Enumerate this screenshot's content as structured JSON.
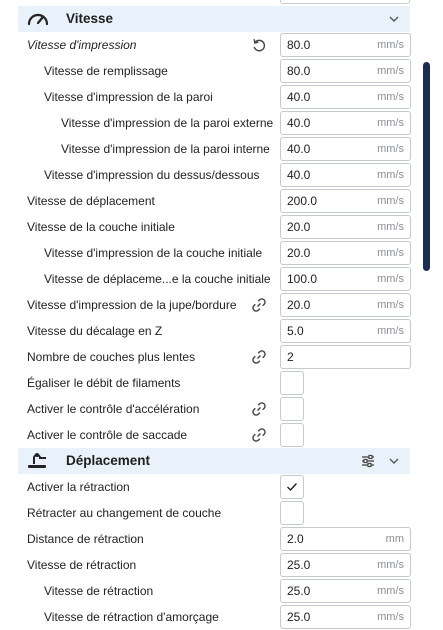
{
  "top_stub": {
    "value": ""
  },
  "sections": {
    "speed": {
      "title": "Vitesse",
      "icon": "speedometer-icon"
    },
    "travel": {
      "title": "Déplacement",
      "icon": "travel-nozzle-icon"
    }
  },
  "rows": [
    {
      "label": "Vitesse d'impression",
      "value": "80.0",
      "unit": "mm/s"
    },
    {
      "label": "Vitesse de remplissage",
      "value": "80.0",
      "unit": "mm/s"
    },
    {
      "label": "Vitesse d'impression de la paroi",
      "value": "40.0",
      "unit": "mm/s"
    },
    {
      "label": "Vitesse d'impression de la paroi externe",
      "value": "40.0",
      "unit": "mm/s"
    },
    {
      "label": "Vitesse d'impression de la paroi interne",
      "value": "40.0",
      "unit": "mm/s"
    },
    {
      "label": "Vitesse d'impression du dessus/dessous",
      "value": "40.0",
      "unit": "mm/s"
    },
    {
      "label": "Vitesse de déplacement",
      "value": "200.0",
      "unit": "mm/s"
    },
    {
      "label": "Vitesse de la couche initiale",
      "value": "20.0",
      "unit": "mm/s"
    },
    {
      "label": "Vitesse d'impression de la couche initiale",
      "value": "20.0",
      "unit": "mm/s"
    },
    {
      "label": "Vitesse de déplaceme...e la couche initiale",
      "value": "100.0",
      "unit": "mm/s"
    },
    {
      "label": "Vitesse d'impression de la jupe/bordure",
      "value": "20.0",
      "unit": "mm/s"
    },
    {
      "label": "Vitesse du décalage en Z",
      "value": "5.0",
      "unit": "mm/s"
    },
    {
      "label": "Nombre de couches plus lentes",
      "value": "2",
      "unit": ""
    },
    {
      "label": "Égaliser le débit de filaments",
      "checked": false
    },
    {
      "label": "Activer le contrôle d'accélération",
      "checked": false
    },
    {
      "label": "Activer le contrôle de saccade",
      "checked": false
    },
    {
      "label": "Activer la rétraction",
      "checked": true
    },
    {
      "label": "Rétracter au changement de couche",
      "checked": false
    },
    {
      "label": "Distance de rétraction",
      "value": "2.0",
      "unit": "mm"
    },
    {
      "label": "Vitesse de rétraction",
      "value": "25.0",
      "unit": "mm/s"
    },
    {
      "label": "Vitesse de rétraction",
      "value": "25.0",
      "unit": "mm/s"
    },
    {
      "label": "Vitesse de rétraction d'amorçage",
      "value": "25.0",
      "unit": "mm/s"
    }
  ],
  "icons": {
    "reset": "reset-icon",
    "link": "link-icon",
    "settings": "settings-sliders-icon",
    "chevron": "chevron-down-icon",
    "check": "checkmark-icon"
  }
}
